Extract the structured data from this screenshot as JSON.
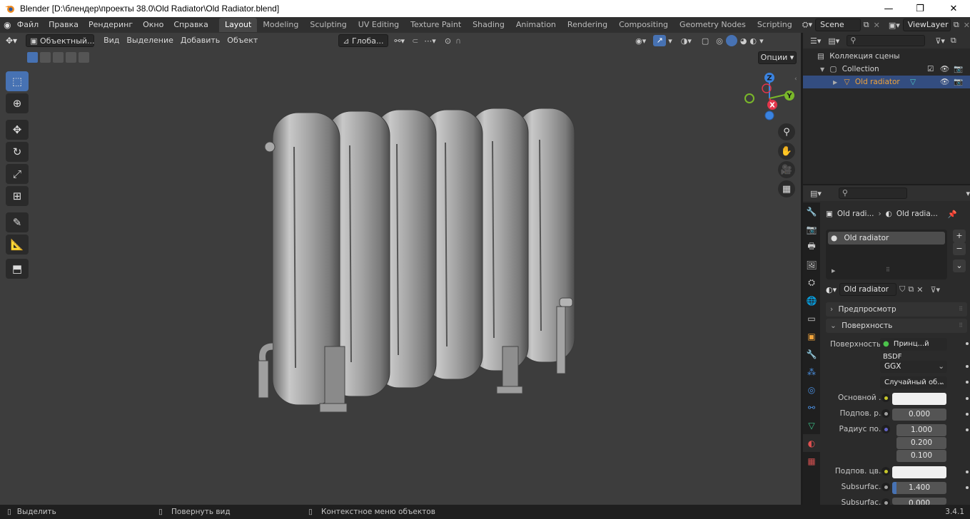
{
  "window": {
    "title": "Blender [D:\\блендер\\проекты 38.0\\Old Radiator\\Old Radiator.blend]",
    "minimize": "—",
    "maximize": "❐",
    "close": "✕"
  },
  "menu": [
    "Файл",
    "Правка",
    "Рендеринг",
    "Окно",
    "Справка"
  ],
  "workspaces": [
    "Layout",
    "Modeling",
    "Sculpting",
    "UV Editing",
    "Texture Paint",
    "Shading",
    "Animation",
    "Rendering",
    "Compositing",
    "Geometry Nodes",
    "Scripting"
  ],
  "active_workspace": "Layout",
  "scene": "Scene",
  "view_layer": "ViewLayer",
  "viewport_header": {
    "mode": "Объектный...",
    "view": "Вид",
    "select": "Выделение",
    "add": "Добавить",
    "object": "Объект",
    "orientation": "Глоба...",
    "options": "Опции"
  },
  "gizmo": {
    "z": "Z",
    "y": "Y",
    "x": "X"
  },
  "outliner": {
    "scene_collection": "Коллекция сцены",
    "collection": "Collection",
    "object": "Old radiator"
  },
  "properties": {
    "breadcrumb_object": "Old radi...",
    "breadcrumb_material": "Old radia...",
    "slot": "Old radiator",
    "material_name": "Old radiator",
    "panels": {
      "preview": "Предпросмотр",
      "surface": "Поверхность"
    },
    "surface_label": "Поверхность",
    "surface_value": "Принц...й BSDF",
    "distribution": "GGX",
    "subsurface_method": "Случайный об...",
    "rows": [
      {
        "label": "Основной ...",
        "value": "",
        "dot": "#c7c72b"
      },
      {
        "label": "Подпов. р...",
        "value": "0.000",
        "dot": "#a1a1a1"
      },
      {
        "label": "Радиус по...",
        "value": "1.000",
        "dot": "#6363c7"
      },
      {
        "label": "",
        "value": "0.200",
        "dot": ""
      },
      {
        "label": "",
        "value": "0.100",
        "dot": ""
      },
      {
        "label": "Подпов. цв...",
        "value": "",
        "dot": "#c7c72b"
      },
      {
        "label": "Subsurfac...",
        "value": "1.400",
        "dot": "#a1a1a1"
      },
      {
        "label": "Subsurfac...",
        "value": "0.000",
        "dot": "#a1a1a1"
      }
    ]
  },
  "status": {
    "select": "Выделить",
    "rotate": "Повернуть вид",
    "context": "Контекстное меню объектов",
    "version": "3.4.1"
  },
  "colors": {
    "accent": "#4772b3",
    "viewport_bg": "#3d3d3d",
    "panel_bg": "#2b2b2b",
    "axis_x": "#e3354b",
    "axis_y": "#7ab82a",
    "axis_z": "#3a83e0",
    "object_orange": "#f0a33b"
  }
}
